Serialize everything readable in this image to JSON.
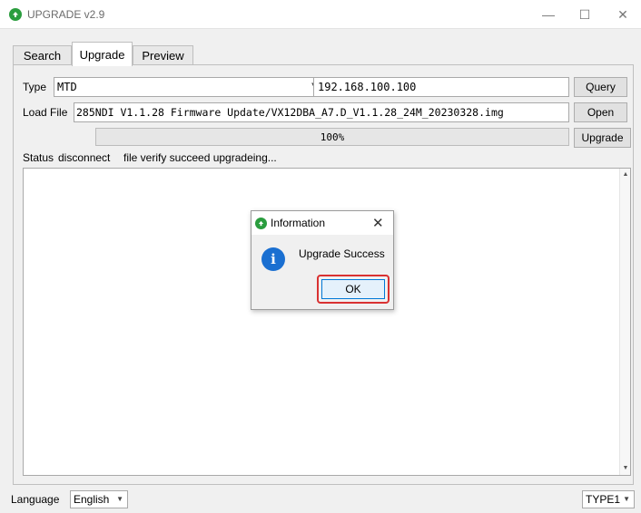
{
  "window": {
    "title": "UPGRADE v2.9",
    "minimize_glyph": "—",
    "maximize_glyph": "☐",
    "close_glyph": "✕"
  },
  "tabs": [
    {
      "label": "Search",
      "active": false
    },
    {
      "label": "Upgrade",
      "active": true
    },
    {
      "label": "Preview",
      "active": false
    }
  ],
  "upgrade": {
    "type_label": "Type",
    "type_value": "MTD",
    "ip_value": "192.168.100.100",
    "query_label": "Query",
    "load_file_label": "Load File",
    "load_file_value": "285NDI V1.1.28 Firmware Update/VX12DBA_A7.D_V1.1.28_24M_20230328.img",
    "open_label": "Open",
    "progress_percent": 100,
    "progress_text": "100%",
    "upgrade_label": "Upgrade",
    "status_label": "Status",
    "status_value": "disconnect",
    "status_message": "file verify succeed upgradeing...",
    "log_text": ""
  },
  "dialog": {
    "title": "Information",
    "icon": "info-icon",
    "message": "Upgrade Success",
    "ok_label": "OK",
    "highlight_color": "#d93131"
  },
  "footer": {
    "language_label": "Language",
    "language_value": "English",
    "type_value": "TYPE1"
  },
  "colors": {
    "app_icon": "#2a9d3e",
    "info_icon": "#1a6fd1",
    "focus_border": "#0078d7"
  }
}
